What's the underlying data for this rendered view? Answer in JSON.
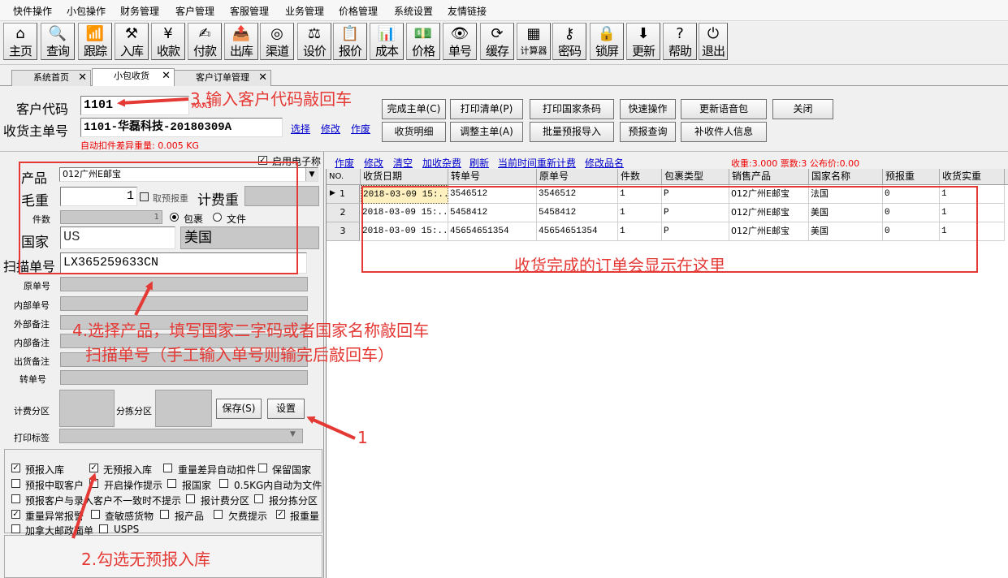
{
  "menu": [
    "快件操作",
    "小包操作",
    "财务管理",
    "客户管理",
    "客服管理",
    "业务管理",
    "价格管理",
    "系统设置",
    "友情链接"
  ],
  "toolbar": [
    {
      "label": "主页",
      "icon": "home-icon",
      "glyph": "⌂"
    },
    {
      "label": "查询",
      "icon": "search-icon",
      "glyph": "🔍"
    },
    {
      "label": "跟踪",
      "icon": "wifi-icon",
      "glyph": "📶"
    },
    {
      "label": "入库",
      "icon": "hammer-icon",
      "glyph": "⚒"
    },
    {
      "label": "收款",
      "icon": "yen-icon",
      "glyph": "¥"
    },
    {
      "label": "付款",
      "icon": "pay-icon",
      "glyph": "✍"
    },
    {
      "label": "出库",
      "icon": "outbox-icon",
      "glyph": "📤"
    },
    {
      "label": "渠道",
      "icon": "channel-icon",
      "glyph": "◎"
    },
    {
      "label": "设价",
      "icon": "scale-icon",
      "glyph": "⚖"
    },
    {
      "label": "报价",
      "icon": "quote-icon",
      "glyph": "📋"
    },
    {
      "label": "成本",
      "icon": "chart-icon",
      "glyph": "📊"
    },
    {
      "label": "价格",
      "icon": "price-icon",
      "glyph": "💵"
    },
    {
      "label": "单号",
      "icon": "eye-icon",
      "glyph": "👁"
    },
    {
      "label": "缓存",
      "icon": "refresh-icon",
      "glyph": "⟳"
    },
    {
      "label": "计算器",
      "icon": "calculator-icon",
      "glyph": "▦"
    },
    {
      "label": "密码",
      "icon": "key-icon",
      "glyph": "⚷"
    },
    {
      "label": "锁屏",
      "icon": "lock-icon",
      "glyph": "🔒"
    },
    {
      "label": "更新",
      "icon": "download-icon",
      "glyph": "⬇"
    },
    {
      "label": "帮助",
      "icon": "help-icon",
      "glyph": "?"
    },
    {
      "label": "退出",
      "icon": "power-icon",
      "glyph": "⏻"
    }
  ],
  "tabs": [
    {
      "label": "系统首页"
    },
    {
      "label": "小包收货"
    },
    {
      "label": "客户订单管理"
    }
  ],
  "header": {
    "customer_code_label": "客户代码",
    "customer_code_value": "1101",
    "customer_code_hint": "AAA3",
    "master_no_label": "收货主单号",
    "master_no_value": "1101-华磊科技-20180309A",
    "link_select": "选择",
    "link_edit": "修改",
    "link_void": "作废",
    "auto_deduct": "自动扣件差异重量: 0.005 KG"
  },
  "actions": [
    "完成主单(C)",
    "打印清单(P)",
    "打印国家条码",
    "快速操作",
    "更新语音包",
    "关闭",
    "收货明细",
    "调整主单(A)",
    "批量预报导入",
    "预报查询",
    "补收件人信息"
  ],
  "linkbar": {
    "enable_einvoice": "启用电子称",
    "links": [
      "作废",
      "修改",
      "清空",
      "加收杂费",
      "刷新",
      "当前时间重新计费",
      "修改品名"
    ],
    "stats": "收重:3.000 票数:3 公布价:0.00"
  },
  "form": {
    "product_label": "产品",
    "product_value": "012广州E邮宝",
    "gross_label": "毛重",
    "gross_value": "1",
    "take_forecast": "取预报重",
    "billing_weight_label": "计费重",
    "pieces_label": "件数",
    "pieces_value": "1",
    "radio_parcel": "包裹",
    "radio_document": "文件",
    "country_label": "国家",
    "country_code": "US",
    "country_name": "美国",
    "scan_label": "扫描单号",
    "scan_value": "LX365259633CN",
    "other_labels": [
      "原单号",
      "内部单号",
      "外部备注",
      "内部备注",
      "出货备注",
      "转单号"
    ],
    "billing_zone": "计费分区",
    "sort_zone": "分拣分区",
    "save_btn": "保存(S)",
    "settings_btn": "设置",
    "print_label": "打印标签"
  },
  "options": [
    {
      "label": "预报入库",
      "checked": true
    },
    {
      "label": "无预报入库",
      "checked": true
    },
    {
      "label": "重量差异自动扣件",
      "checked": false
    },
    {
      "label": "保留国家",
      "checked": false
    },
    {
      "label": "预报中取客户",
      "checked": false
    },
    {
      "label": "开启操作提示",
      "checked": false
    },
    {
      "label": "报国家",
      "checked": false
    },
    {
      "label": "0.5KG内自动为文件",
      "checked": false
    },
    {
      "label": "预报客户与录入客户不一致时不提示",
      "checked": false
    },
    {
      "label": "报计费分区",
      "checked": false
    },
    {
      "label": "报分拣分区",
      "checked": false
    },
    {
      "label": "重量异常报警",
      "checked": true
    },
    {
      "label": "查敏感货物",
      "checked": false
    },
    {
      "label": "报产品",
      "checked": false
    },
    {
      "label": "欠费提示",
      "checked": false
    },
    {
      "label": "报重量",
      "checked": true
    },
    {
      "label": "加拿大邮政面单",
      "checked": false
    },
    {
      "label": "USPS",
      "checked": false
    }
  ],
  "table": {
    "columns": [
      "NO.",
      "收货日期",
      "转单号",
      "原单号",
      "件数",
      "包裹类型",
      "销售产品",
      "国家名称",
      "预报重",
      "收货实重"
    ],
    "rows": [
      [
        "1",
        "2018-03-09 15:...",
        "3546512",
        "3546512",
        "1",
        "P",
        "012广州E邮宝",
        "法国",
        "0",
        "1"
      ],
      [
        "2",
        "2018-03-09 15:...",
        "5458412",
        "5458412",
        "1",
        "P",
        "012广州E邮宝",
        "美国",
        "0",
        "1"
      ],
      [
        "3",
        "2018-03-09 15:...",
        "45654651354",
        "45654651354",
        "1",
        "P",
        "012广州E邮宝",
        "美国",
        "0",
        "1"
      ]
    ]
  },
  "annotations": {
    "step3": "3.输入客户代码敲回车",
    "step4a": "4.选择产品，填写国家二字码或者国家名称敲回车",
    "step4b": "扫描单号（手工输入单号则输完后敲回车）",
    "step1": "1",
    "step2": "2.勾选无预报入库",
    "grid_note": "收货完成的订单会显示在这里"
  },
  "colors": {
    "annotation": "#e53935",
    "link": "#0000cc",
    "stats": "#e00000"
  }
}
